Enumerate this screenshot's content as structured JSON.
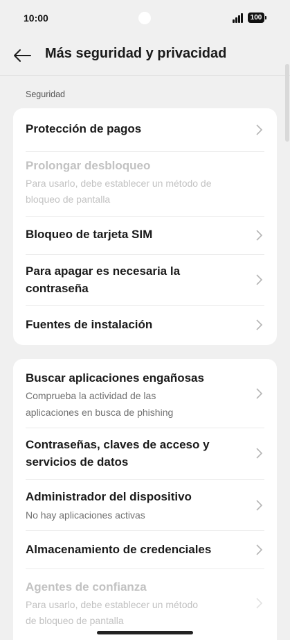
{
  "status": {
    "time": "10:00",
    "battery": "100"
  },
  "header": {
    "title": "Más seguridad y privacidad"
  },
  "section": {
    "label": "Seguridad"
  },
  "card1": [
    {
      "label": "Protección de pagos"
    },
    {
      "label": "Prolongar desbloqueo",
      "sub1": "Para usarlo, debe establecer un método de",
      "sub2": "bloqueo de pantalla"
    },
    {
      "label": "Bloqueo de tarjeta SIM"
    },
    {
      "label1": "Para apagar es necesaria la",
      "label2": "contraseña"
    },
    {
      "label": "Fuentes de instalación"
    }
  ],
  "card2": [
    {
      "label": "Buscar aplicaciones engañosas",
      "sub1": "Comprueba la actividad de las",
      "sub2": "aplicaciones en busca de phishing"
    },
    {
      "label1": "Contraseñas, claves de acceso y",
      "label2": "servicios de datos"
    },
    {
      "label": "Administrador del dispositivo",
      "sub": "No hay aplicaciones activas"
    },
    {
      "label": "Almacenamiento de credenciales"
    },
    {
      "label": "Agentes de confianza",
      "sub1": "Para usarlo, debe establecer un método",
      "sub2": "de bloqueo de pantalla"
    }
  ]
}
